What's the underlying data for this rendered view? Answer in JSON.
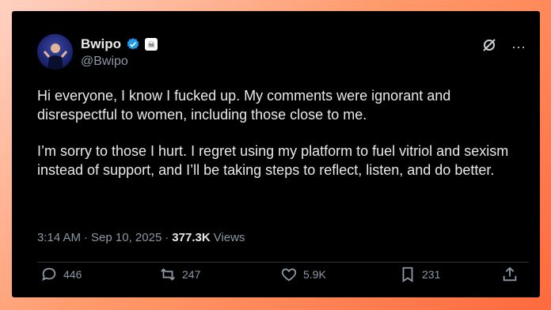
{
  "tweet": {
    "author_name": "Bwipo",
    "handle": "@Bwipo",
    "affiliation_icon": "skull-crossbones-icon",
    "paragraphs": [
      "Hi everyone, I know I fucked up. My comments were ignorant and disrespectful to women, including those close to me.",
      "I’m sorry to those I hurt. I regret using my platform to fuel vitriol and sexism instead of support, and I’ll be taking steps to reflect, listen, and do better."
    ],
    "time": "3:14 AM",
    "separator": "·",
    "date": "Sep 10, 2025",
    "views_count": "377.3K",
    "views_label": "Views"
  },
  "actions": {
    "replies": "446",
    "reposts": "247",
    "likes": "5.9K",
    "bookmarks": "231"
  },
  "colors": {
    "background_gradient": [
      "#ffd2c2",
      "#ff6a3d"
    ],
    "card": "#000000",
    "verified": "#1d9bf0",
    "muted_text": "#8b98a5"
  }
}
